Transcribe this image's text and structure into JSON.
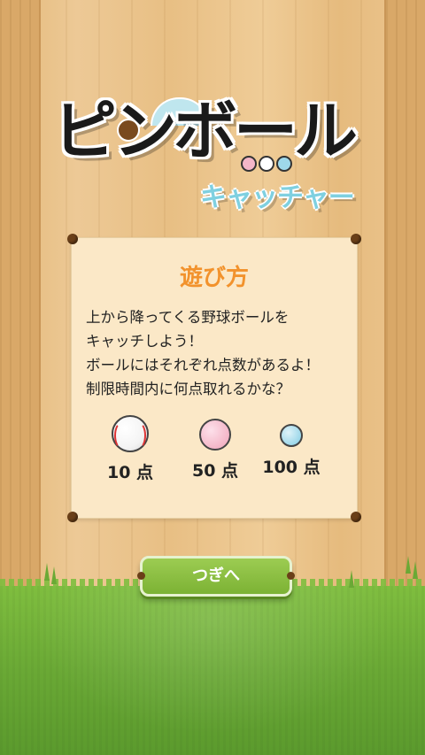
{
  "logo": {
    "main": "ピンボール",
    "sub": "キャッチャー"
  },
  "board": {
    "title": "遊び方",
    "lines": [
      "上から降ってくる野球ボールを",
      "キャッチしよう！",
      "ボールにはそれぞれ点数があるよ！",
      "制限時間内に何点取れるかな？"
    ],
    "scores": [
      {
        "ball": "baseball-icon",
        "label": "10 点"
      },
      {
        "ball": "pink-ball-icon",
        "label": "50 点"
      },
      {
        "ball": "blue-ball-icon",
        "label": "100 点"
      }
    ]
  },
  "next_button": {
    "label": "つぎへ"
  },
  "colors": {
    "title_orange": "#f2922c",
    "button_green": "#7cb234",
    "pink_ball": "#f4b6c8",
    "blue_ball": "#9ed8ea"
  }
}
